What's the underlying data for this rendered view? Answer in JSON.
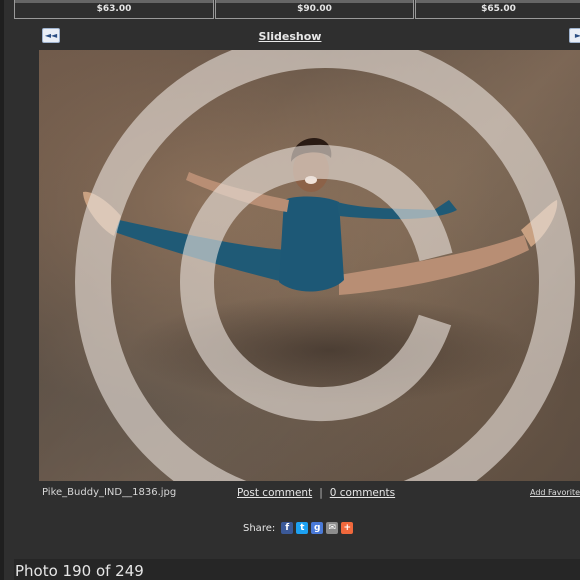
{
  "prices": [
    "$63.00",
    "$90.00",
    "$65.00"
  ],
  "nav": {
    "prev_glyph": "◄◄",
    "next_glyph": "►",
    "slideshow_label": "Slideshow"
  },
  "photo": {
    "filename": "Pike_Buddy_IND__1836.jpg",
    "watermark_icon": "copyright-watermark"
  },
  "comments": {
    "post_label": "Post comment",
    "separator": "|",
    "count_label": "0 comments"
  },
  "favorites": {
    "label": "Add Favorite"
  },
  "share": {
    "label": "Share:",
    "icons": [
      {
        "name": "facebook-icon",
        "glyph": "f",
        "color": "#3b5998"
      },
      {
        "name": "twitter-icon",
        "glyph": "t",
        "color": "#1da1f2"
      },
      {
        "name": "google-plus-icon",
        "glyph": "g",
        "color": "#4a7ad8"
      },
      {
        "name": "email-icon",
        "glyph": "✉",
        "color": "#8c8c8c"
      },
      {
        "name": "more-icon",
        "glyph": "+",
        "color": "#f0683c"
      }
    ]
  },
  "footer": {
    "photo_count": "Photo 190 of 249"
  }
}
